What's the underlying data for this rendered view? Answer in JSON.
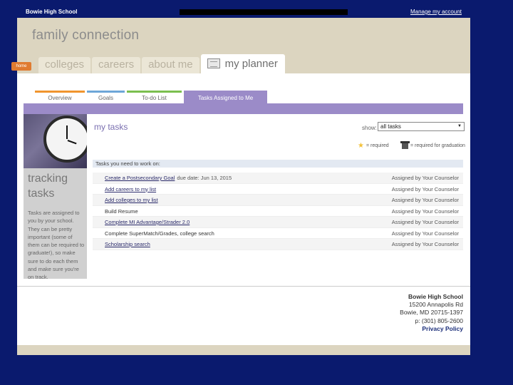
{
  "topbar": {
    "school": "Bowie High School",
    "manage": "Manage my account"
  },
  "brand": "family connection",
  "home": "home",
  "nav": {
    "tabs": [
      "colleges",
      "careers",
      "about me"
    ],
    "active": "my planner"
  },
  "subtabs": [
    "Overview",
    "Goals",
    "To-do List",
    "Tasks Assigned to Me"
  ],
  "sidebar": {
    "heading_line1": "tracking",
    "heading_line2": "tasks",
    "description": "Tasks are assigned to you by your school. They can be pretty important (some of them can be required to graduate!), so make sure to do each them and make sure you're on track."
  },
  "main": {
    "title": "my tasks",
    "show_label": "show:",
    "show_value": "all tasks",
    "legend_required": "= required",
    "legend_graduation": "= required for graduation",
    "list_header": "Tasks you need to work on:",
    "tasks": [
      {
        "name": "Create a Postsecondary Goal",
        "due": "due date: Jun 13, 2015",
        "by": "Assigned by Your Counselor",
        "link": true
      },
      {
        "name": "Add careers to my list",
        "due": "",
        "by": "Assigned by Your Counselor",
        "link": true
      },
      {
        "name": "Add colleges to my list",
        "due": "",
        "by": "Assigned by Your Counselor",
        "link": true
      },
      {
        "name": "Build Resume",
        "due": "",
        "by": "Assigned by Your Counselor",
        "link": false
      },
      {
        "name": "Complete MI Advantage/Strader 2.0",
        "due": "",
        "by": "Assigned by Your Counselor",
        "link": true
      },
      {
        "name": "Complete SuperMatch/Grades, college search",
        "due": "",
        "by": "Assigned by Your Counselor",
        "link": false
      },
      {
        "name": "Scholarship search",
        "due": "",
        "by": "Assigned by Your Counselor",
        "link": true
      }
    ]
  },
  "footer": {
    "name": "Bowie High School",
    "address1": "15200 Annapolis Rd",
    "address2": "Bowie, MD 20715-1397",
    "phone": "p: (301) 805-2600",
    "privacy": "Privacy Policy"
  }
}
